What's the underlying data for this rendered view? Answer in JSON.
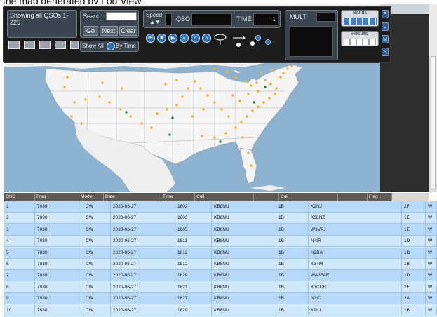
{
  "page_title_fragment": "the map generated by Log View.",
  "toolbar": {
    "status_text": "Showing all QSOs 1-225",
    "search_label": "Search",
    "search_value": "",
    "go_label": "Go",
    "next_label": "Next",
    "clear_label": "Clear",
    "show_all_label": "Show All",
    "by_time_label": "By Time",
    "speed_label": "Speed",
    "qso_label": "QSO",
    "time_label": "TIME",
    "time_value": "1",
    "mult_label": "MULT",
    "bands_label": "Bands",
    "results_label": "Results",
    "side_letters": [
      "C",
      "M",
      "S"
    ]
  },
  "table": {
    "columns": [
      "QSO",
      "Freq",
      "Mode",
      "Date",
      "Time",
      "Call",
      "",
      "Call",
      "",
      "Flag"
    ],
    "rows": [
      [
        "1",
        "7030",
        "CW",
        "2020-06-27",
        "1802",
        "KB8NU",
        "1B",
        "K2NJ",
        "2F",
        "W"
      ],
      [
        "2",
        "7030",
        "CW",
        "2020-06-27",
        "1803",
        "KB8NU",
        "1B",
        "K3LNZ",
        "1E",
        "W"
      ],
      [
        "3",
        "7030",
        "CW",
        "2020-06-27",
        "1805",
        "KB8NU",
        "1B",
        "W3VPJ",
        "1E",
        "W"
      ],
      [
        "4",
        "7030",
        "CW",
        "2020-06-27",
        "1811",
        "KB8NU",
        "1B",
        "N4IR",
        "1D",
        "W"
      ],
      [
        "5",
        "7030",
        "CW",
        "2020-06-27",
        "1812",
        "KB8NU",
        "1B",
        "N2BA",
        "1D",
        "W"
      ],
      [
        "6",
        "7030",
        "CW",
        "2020-06-27",
        "1812",
        "KB8NU",
        "1B",
        "K3TM",
        "1B",
        "W"
      ],
      [
        "7",
        "7030",
        "CW",
        "2020-06-27",
        "1820",
        "KB8NU",
        "1B",
        "WA3FAE",
        "1D",
        "W"
      ],
      [
        "8",
        "7030",
        "CW",
        "2020-06-27",
        "1821",
        "KB8NU",
        "1B",
        "K3CCR",
        "2E",
        "W"
      ],
      [
        "9",
        "7030",
        "CW",
        "2020-06-27",
        "1827",
        "KB8NU",
        "1B",
        "N3IC",
        "3A",
        "W"
      ],
      [
        "10",
        "7030",
        "CW",
        "2020-06-27",
        "1829",
        "KB8NU",
        "1B",
        "K9IU",
        "1B",
        "W"
      ]
    ]
  },
  "colors": {
    "ocean": "#8fb2cf",
    "land": "#f2f2f2",
    "qso_dot": "#f2b233",
    "multiplier_dot": "#2e8b3a",
    "header_bg": "#5a5a5a",
    "row_alt": "#b7d8f6",
    "row_base": "#cfe6fb"
  },
  "icons": {
    "home": "home-icon",
    "speed": "speed-arrows-icon",
    "playback": [
      "skip-back-icon",
      "stop-icon",
      "play-icon",
      "fast-forward-icon",
      "faster-icon",
      "fastest-icon"
    ]
  }
}
